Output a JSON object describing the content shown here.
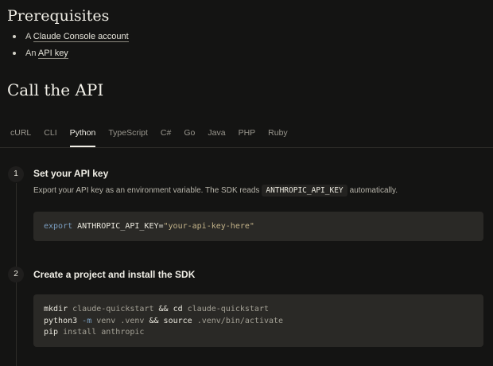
{
  "prerequisites": {
    "title": "Prerequisites",
    "items": [
      {
        "prefix": "A ",
        "link": "Claude Console account"
      },
      {
        "prefix": "An ",
        "link": "API key"
      }
    ]
  },
  "call_api": {
    "title": "Call the API",
    "tabs": [
      "cURL",
      "CLI",
      "Python",
      "TypeScript",
      "C#",
      "Go",
      "Java",
      "PHP",
      "Ruby"
    ],
    "active_tab": "Python"
  },
  "steps": [
    {
      "number": "1",
      "title": "Set your API key",
      "desc_before": "Export your API key as an environment variable. The SDK reads",
      "desc_code": "ANTHROPIC_API_KEY",
      "desc_after": "automatically.",
      "code": {
        "keyword": "export",
        "var": " ANTHROPIC_API_KEY=",
        "string": "\"your-api-key-here\""
      }
    },
    {
      "number": "2",
      "title": "Create a project and install the SDK",
      "code_lines": [
        {
          "cmd": "mkdir",
          "args": " claude-quickstart",
          "op": " && ",
          "cmd2": "cd",
          "args2": " claude-quickstart"
        },
        {
          "cmd": "python3",
          "flag": " -m",
          "args": " venv .venv",
          "op": " && ",
          "cmd2": "source",
          "args2": " .venv/bin/activate"
        },
        {
          "cmd": "pip",
          "args": " install anthropic"
        }
      ]
    }
  ],
  "colors": {
    "background": "#141413",
    "code_background": "#2a2926",
    "keyword": "#7b9fc2",
    "string": "#c4b48a"
  }
}
